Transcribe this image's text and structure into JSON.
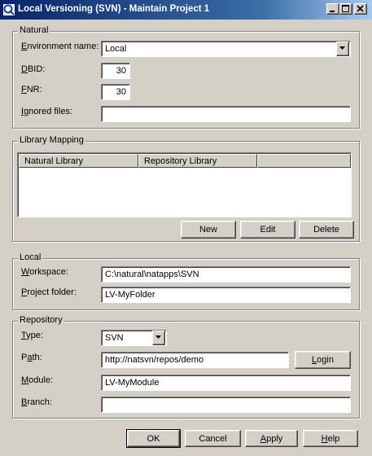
{
  "window": {
    "title": "Local Versioning (SVN) - Maintain Project 1"
  },
  "natural": {
    "legend": "Natural",
    "env_label": "Environment name:",
    "env_value": "Local",
    "dbid_label": "DBID:",
    "dbid_value": "30",
    "fnr_label": "FNR:",
    "fnr_value": "30",
    "ignored_label": "Ignored files:",
    "ignored_value": ""
  },
  "mapping": {
    "legend": "Library Mapping",
    "columns": [
      "Natural Library",
      "Repository Library",
      ""
    ],
    "rows": [],
    "buttons": {
      "new": "New",
      "edit": "Edit",
      "delete": "Delete"
    }
  },
  "local": {
    "legend": "Local",
    "workspace_label": "Workspace:",
    "workspace_value": "C:\\natural\\natapps\\SVN",
    "project_label": "Project folder:",
    "project_value": "LV-MyFolder"
  },
  "repository": {
    "legend": "Repository",
    "type_label": "Type:",
    "type_value": "SVN",
    "path_label": "Path:",
    "path_value": "http://natsvn/repos/demo",
    "login_label": "Login",
    "module_label": "Module:",
    "module_value": "LV-MyModule",
    "branch_label": "Branch:",
    "branch_value": ""
  },
  "footer": {
    "ok": "OK",
    "cancel": "Cancel",
    "apply": "Apply",
    "help": "Help"
  },
  "colors": {
    "title_bar": "#0a246a",
    "face": "#d4d0c8"
  },
  "icons": {
    "app": "app-icon",
    "minimize": "minimize-icon",
    "maximize": "maximize-icon",
    "close": "close-icon",
    "dropdown": "chevron-down-icon"
  }
}
